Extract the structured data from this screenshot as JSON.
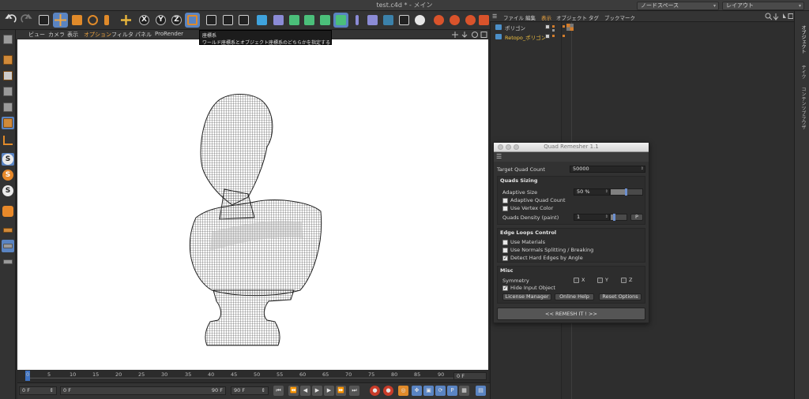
{
  "window": {
    "title": "test.c4d * - メイン",
    "node_space": "ノードスペース",
    "layout": "レイアウト"
  },
  "toolbar": {
    "axis_x": "X",
    "axis_y": "Y",
    "axis_z": "Z"
  },
  "viewport_menu": [
    "ビュー",
    "カメラ",
    "表示",
    "オプション",
    "フィルタ",
    "パネル",
    "ProRender"
  ],
  "tooltip": {
    "title": "座標系",
    "text": "ワールド座標系とオブジェクト座標系のどちらかを指定する"
  },
  "left_toolbar": {
    "icon_s": "S"
  },
  "timeline": {
    "ticks": [
      "0",
      "5",
      "10",
      "15",
      "20",
      "25",
      "30",
      "35",
      "40",
      "45",
      "50",
      "55",
      "60",
      "65",
      "70",
      "75",
      "80",
      "85",
      "90"
    ],
    "current_frame": "0 F",
    "end_frame": "90"
  },
  "transport": {
    "start_field": "0 F",
    "range_min": "0 F",
    "range_max": "90 F",
    "end_field": "90 F"
  },
  "object_manager": {
    "menu": [
      "ファイル",
      "編集",
      "表示",
      "オブジェクト",
      "タグ",
      "ブックマーク"
    ],
    "objects": [
      {
        "name": "ポリゴン"
      },
      {
        "name": "Retopo_ポリゴン"
      }
    ]
  },
  "right_tabs": [
    "オブジェクト",
    "テイク",
    "コンテンツブラウザ"
  ],
  "quad_remesher": {
    "title": "Quad Remesher 1.1",
    "target_quad_count_label": "Target Quad Count",
    "target_quad_count": "50000",
    "quads_sizing_title": "Quads Sizing",
    "adaptive_size_label": "Adaptive Size",
    "adaptive_size": "50 %",
    "adaptive_size_level": 0.5,
    "adaptive_quad_count_label": "Adaptive Quad Count",
    "adaptive_quad_count": false,
    "use_vertex_color_label": "Use Vertex Color",
    "use_vertex_color": false,
    "quads_density_label": "Quads Density (paint)",
    "quads_density": "1",
    "quads_density_level": 0.25,
    "paint_button": "P",
    "edge_loops_title": "Edge Loops Control",
    "use_materials_label": "Use Materials",
    "use_materials": false,
    "use_normals_label": "Use Normals Splitting / Breaking",
    "use_normals": false,
    "detect_hard_edges_label": "Detect Hard Edges by Angle",
    "detect_hard_edges": true,
    "misc_title": "Misc",
    "symmetry_label": "Symmetry",
    "sym_x": "X",
    "sym_y": "Y",
    "sym_z": "Z",
    "hide_input_label": "Hide Input Object",
    "hide_input": true,
    "license_button": "License Manager",
    "help_button": "Online Help",
    "reset_button": "Reset Options",
    "remesh_button": "<<   REMESH IT !   >>"
  }
}
